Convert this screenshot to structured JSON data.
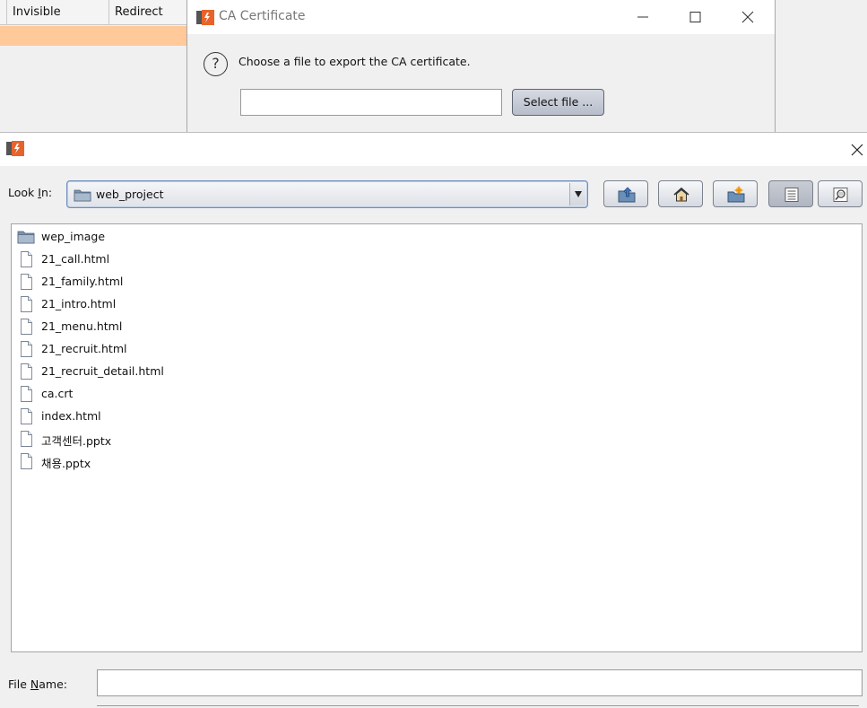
{
  "background_table": {
    "columns": [
      "",
      "Invisible",
      "Redirect"
    ],
    "colors": {
      "selected_row": "#ffc99a"
    }
  },
  "ca_dialog": {
    "title": "CA Certificate",
    "message": "Choose a file to export the CA certificate.",
    "input_value": "",
    "select_button": "Select file ...",
    "icons": {
      "logo": "burp-logo-icon",
      "minimize": "minimize-icon",
      "maximize": "maximize-icon",
      "close": "close-icon",
      "question": "question-icon"
    }
  },
  "file_chooser": {
    "title": "",
    "look_in": {
      "label_pre": "Look ",
      "label_mnemonic": "I",
      "label_post": "n:",
      "value": "web_project"
    },
    "toolbar": [
      {
        "name": "up-one-level-button",
        "icon": "folder-up-icon"
      },
      {
        "name": "home-button",
        "icon": "home-icon"
      },
      {
        "name": "new-folder-button",
        "icon": "new-folder-icon"
      },
      {
        "name": "list-view-button",
        "icon": "list-view-icon",
        "pressed": true
      },
      {
        "name": "details-view-button",
        "icon": "details-view-icon"
      }
    ],
    "files": [
      {
        "name": "wep_image",
        "type": "folder"
      },
      {
        "name": "21_call.html",
        "type": "file"
      },
      {
        "name": "21_family.html",
        "type": "file"
      },
      {
        "name": "21_intro.html",
        "type": "file"
      },
      {
        "name": "21_menu.html",
        "type": "file"
      },
      {
        "name": "21_recruit.html",
        "type": "file"
      },
      {
        "name": "21_recruit_detail.html",
        "type": "file"
      },
      {
        "name": "ca.crt",
        "type": "file"
      },
      {
        "name": "index.html",
        "type": "file"
      },
      {
        "name": "고객센터.pptx",
        "type": "file"
      },
      {
        "name": "채용.pptx",
        "type": "file"
      }
    ],
    "file_name": {
      "label_pre": "File ",
      "label_mnemonic": "N",
      "label_post": "ame:",
      "value": ""
    }
  }
}
